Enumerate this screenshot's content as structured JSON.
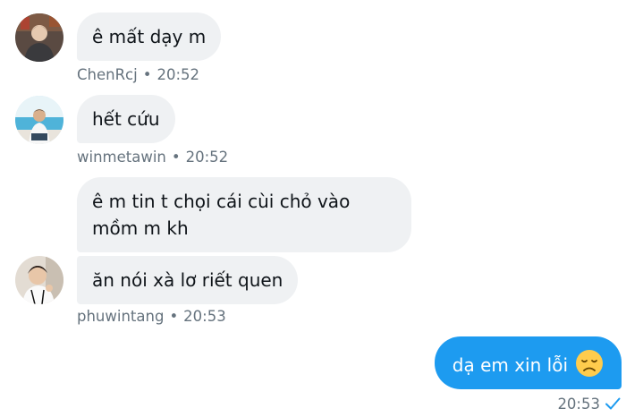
{
  "messages": [
    {
      "text": "ê mất dạy m",
      "sender": "ChenRcj",
      "time": "20:52"
    },
    {
      "text": "hết cứu",
      "sender": "winmetawin",
      "time": "20:52"
    },
    {
      "text": "ê m tin t chọi cái cùi chỏ vào mồm m kh",
      "sender": "phuwintang",
      "time": "20:53"
    },
    {
      "text": "ăn nói xà lơ riết quen"
    },
    {
      "text": "dạ em xin lỗi",
      "emoji": "disappointed-face-icon",
      "time": "20:53",
      "status": "sent-check-icon"
    }
  ],
  "colors": {
    "sent_bubble": "#1d9bf0",
    "received_bubble": "#eff1f3",
    "meta_text": "#66737e",
    "check": "#1d9bf0"
  }
}
